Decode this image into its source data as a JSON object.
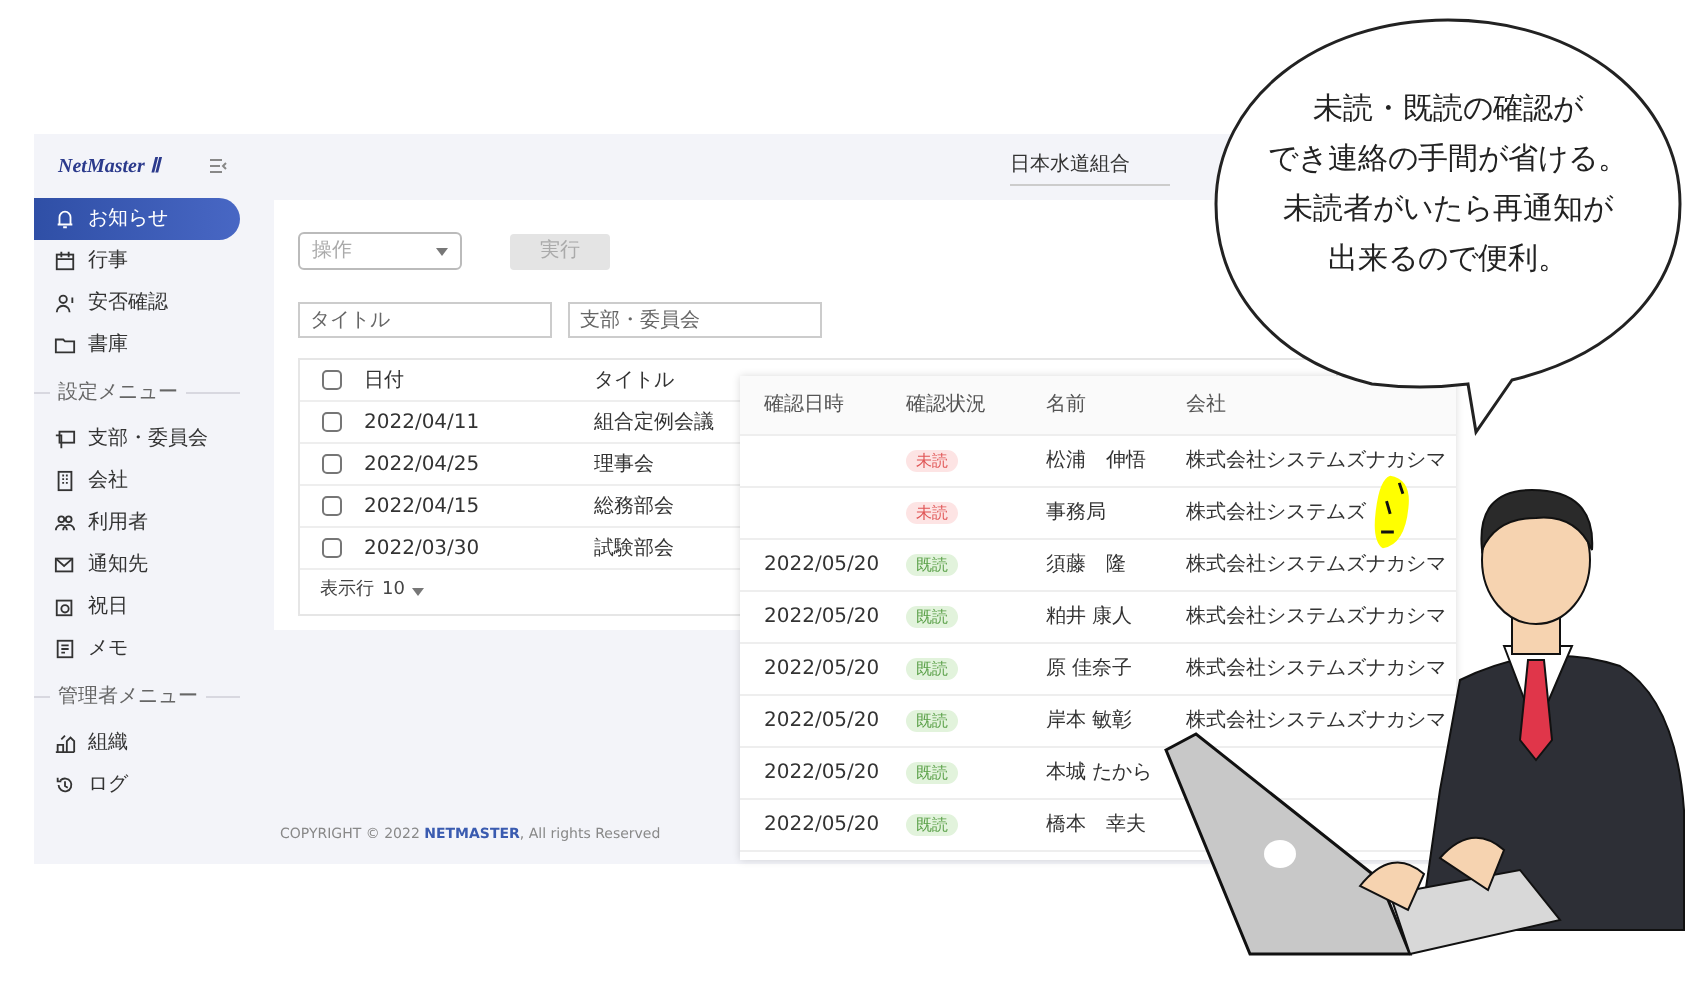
{
  "logo": "NetMaster Ⅱ",
  "header": {
    "organization": "日本水道組合"
  },
  "sidebar": {
    "groups": [
      {
        "items": [
          {
            "label": "お知らせ",
            "selected": true
          },
          {
            "label": "行事",
            "selected": false
          },
          {
            "label": "安否確認",
            "selected": false
          },
          {
            "label": "書庫",
            "selected": false
          }
        ]
      },
      {
        "title": "設定メニュー",
        "items": [
          {
            "label": "支部・委員会",
            "selected": false
          },
          {
            "label": "会社",
            "selected": false
          },
          {
            "label": "利用者",
            "selected": false
          },
          {
            "label": "通知先",
            "selected": false
          },
          {
            "label": "祝日",
            "selected": false
          },
          {
            "label": "メモ",
            "selected": false
          }
        ]
      },
      {
        "title": "管理者メニュー",
        "items": [
          {
            "label": "組織",
            "selected": false
          },
          {
            "label": "ログ",
            "selected": false
          }
        ]
      }
    ]
  },
  "toolbar": {
    "action_select": {
      "placeholder": "操作"
    },
    "run_button": {
      "label": "実行",
      "disabled": true
    }
  },
  "filters": [
    {
      "placeholder": "タイトル"
    },
    {
      "placeholder": "支部・委員会"
    }
  ],
  "notice_table": {
    "select_all": {
      "checked": false
    },
    "columns": [
      "日付",
      "タイトル"
    ],
    "rows": [
      {
        "checked": false,
        "date": "2022/04/11",
        "title": "組合定例会議"
      },
      {
        "checked": false,
        "date": "2022/04/25",
        "title": "理事会"
      },
      {
        "checked": false,
        "date": "2022/04/15",
        "title": "総務部会"
      },
      {
        "checked": false,
        "date": "2022/03/30",
        "title": "試験部会"
      }
    ],
    "rows_per_page": {
      "label": "表示行",
      "value": "10"
    }
  },
  "footer": {
    "prefix": "COPYRIGHT © 2022",
    "link": "NETMASTER",
    "suffix": ", All rights Reserved"
  },
  "confirmation_table": {
    "columns": [
      "確認日時",
      "確認状況",
      "名前",
      "会社"
    ],
    "rows": [
      {
        "status": "未読",
        "read": false,
        "name": "松浦　伸悟",
        "company": "株式会社システムズナカシマ"
      },
      {
        "status": "未読",
        "read": false,
        "name": "事務局",
        "company": "株式会社システムズ"
      },
      {
        "confirmed_at": "2022/05/20",
        "status": "既読",
        "read": true,
        "name": "須藤　隆",
        "company": "株式会社システムズナカシマ"
      },
      {
        "confirmed_at": "2022/05/20",
        "status": "既読",
        "read": true,
        "name": "粕井 康人",
        "company": "株式会社システムズナカシマ"
      },
      {
        "confirmed_at": "2022/05/20",
        "status": "既読",
        "read": true,
        "name": "原 佳奈子",
        "company": "株式会社システムズナカシマ"
      },
      {
        "confirmed_at": "2022/05/20",
        "status": "既読",
        "read": true,
        "name": "岸本 敏彰",
        "company": "株式会社システムズナカシマ"
      },
      {
        "confirmed_at": "2022/05/20",
        "status": "既読",
        "read": true,
        "name": "本城 たから"
      },
      {
        "confirmed_at": "2022/05/20",
        "status": "既読",
        "read": true,
        "name": "橋本　幸夫"
      }
    ]
  },
  "speech_bubble": {
    "lines": [
      "未読・既読の確認が",
      "でき連絡の手間が省ける。",
      "未読者がいたら再通知が",
      "出来るので便利。"
    ]
  }
}
